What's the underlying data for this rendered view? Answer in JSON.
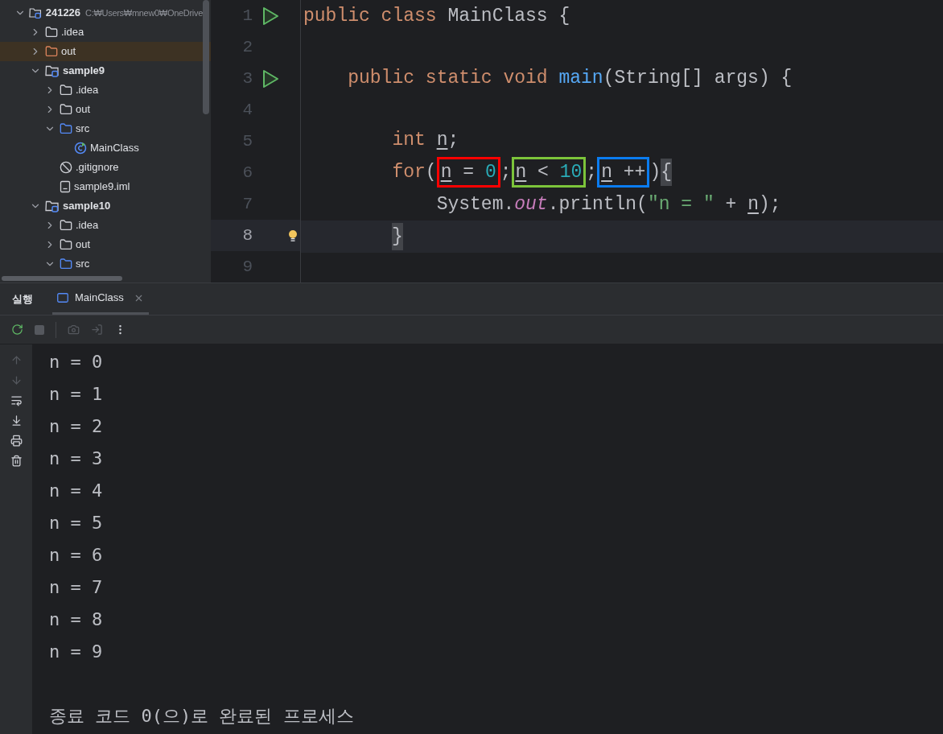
{
  "project_tree": [
    {
      "label": "241226",
      "path": "C:₩Users₩mnew0₩OneDrive",
      "kind": "module",
      "expanded": true,
      "selected": false,
      "children": [
        {
          "label": ".idea",
          "kind": "folder",
          "expanded": false,
          "selected": false
        },
        {
          "label": "out",
          "kind": "excluded",
          "expanded": false,
          "selected": true
        },
        {
          "label": "sample9",
          "kind": "module",
          "expanded": true,
          "selected": false,
          "children": [
            {
              "label": ".idea",
              "kind": "folder",
              "expanded": false,
              "selected": false
            },
            {
              "label": "out",
              "kind": "folder",
              "expanded": false,
              "selected": false
            },
            {
              "label": "src",
              "kind": "source",
              "expanded": true,
              "selected": false,
              "children": [
                {
                  "label": "MainClass",
                  "kind": "class",
                  "selected": false
                }
              ]
            },
            {
              "label": ".gitignore",
              "kind": "ignore",
              "selected": false
            },
            {
              "label": "sample9.iml",
              "kind": "file",
              "selected": false
            }
          ]
        },
        {
          "label": "sample10",
          "kind": "module",
          "expanded": true,
          "selected": false,
          "children": [
            {
              "label": ".idea",
              "kind": "folder",
              "expanded": false,
              "selected": false
            },
            {
              "label": "out",
              "kind": "folder",
              "expanded": false,
              "selected": false
            },
            {
              "label": "src",
              "kind": "source",
              "expanded": true,
              "selected": false
            }
          ]
        }
      ]
    }
  ],
  "editor": {
    "lines": [
      {
        "number": "1",
        "run": true,
        "current": false,
        "hint": false,
        "tokens": [
          {
            "kind": "keyword",
            "text": "public class "
          },
          {
            "kind": "plain",
            "text": "MainClass {"
          }
        ]
      },
      {
        "number": "2",
        "run": false,
        "current": false,
        "hint": false
      },
      {
        "number": "3",
        "run": true,
        "current": false,
        "hint": false,
        "tokens": [
          {
            "kind": "keyword",
            "text": "    public static void "
          },
          {
            "kind": "method",
            "text": "main"
          },
          {
            "kind": "plain",
            "text": "(String[] args) {"
          }
        ]
      },
      {
        "number": "4",
        "run": false,
        "current": false,
        "hint": false
      },
      {
        "number": "5",
        "run": false,
        "current": false,
        "hint": false,
        "tokens": [
          {
            "kind": "keyword",
            "text": "        int "
          },
          {
            "kind": "variable",
            "text": "n"
          },
          {
            "kind": "plain",
            "text": ";"
          }
        ]
      },
      {
        "number": "6",
        "run": false,
        "current": false,
        "hint": false,
        "tokens": [
          {
            "kind": "keyword",
            "text": "        for"
          },
          {
            "kind": "plain",
            "text": "("
          },
          {
            "kind": "box",
            "color": "#ff0000",
            "tokens": [
              {
                "kind": "variable",
                "text": "n"
              },
              {
                "kind": "plain",
                "text": " = "
              },
              {
                "kind": "number",
                "text": "0"
              }
            ]
          },
          {
            "kind": "plain",
            "text": ";"
          },
          {
            "kind": "box",
            "color": "#7cc43a",
            "tokens": [
              {
                "kind": "variable",
                "text": "n"
              },
              {
                "kind": "plain",
                "text": " < "
              },
              {
                "kind": "number",
                "text": "10"
              }
            ]
          },
          {
            "kind": "plain",
            "text": ";"
          },
          {
            "kind": "box",
            "color": "#0a7cf0",
            "tokens": [
              {
                "kind": "variable",
                "text": "n"
              },
              {
                "kind": "plain",
                "text": " ++"
              }
            ]
          },
          {
            "kind": "plain",
            "text": ")"
          },
          {
            "kind": "brace",
            "text": "{"
          }
        ]
      },
      {
        "number": "7",
        "run": false,
        "current": false,
        "hint": false,
        "tokens": [
          {
            "kind": "plain",
            "text": "            System."
          },
          {
            "kind": "field",
            "text": "out"
          },
          {
            "kind": "plain",
            "text": ".println("
          },
          {
            "kind": "string",
            "text": "\"n = \""
          },
          {
            "kind": "plain",
            "text": " + "
          },
          {
            "kind": "variable",
            "text": "n"
          },
          {
            "kind": "plain",
            "text": ");"
          }
        ]
      },
      {
        "number": "8",
        "run": false,
        "current": true,
        "hint": true,
        "tokens": [
          {
            "kind": "closing_brace",
            "text": "}"
          }
        ]
      },
      {
        "number": "9",
        "run": false,
        "current": false,
        "hint": false
      }
    ]
  },
  "run_panel": {
    "title": "실행",
    "tabs": [
      {
        "label": "MainClass",
        "selected": true
      }
    ],
    "output": [
      "n = 0",
      "n = 1",
      "n = 2",
      "n = 3",
      "n = 4",
      "n = 5",
      "n = 6",
      "n = 7",
      "n = 8",
      "n = 9"
    ],
    "exit_message": "종료 코드 0(으)로 완료된 프로세스"
  }
}
